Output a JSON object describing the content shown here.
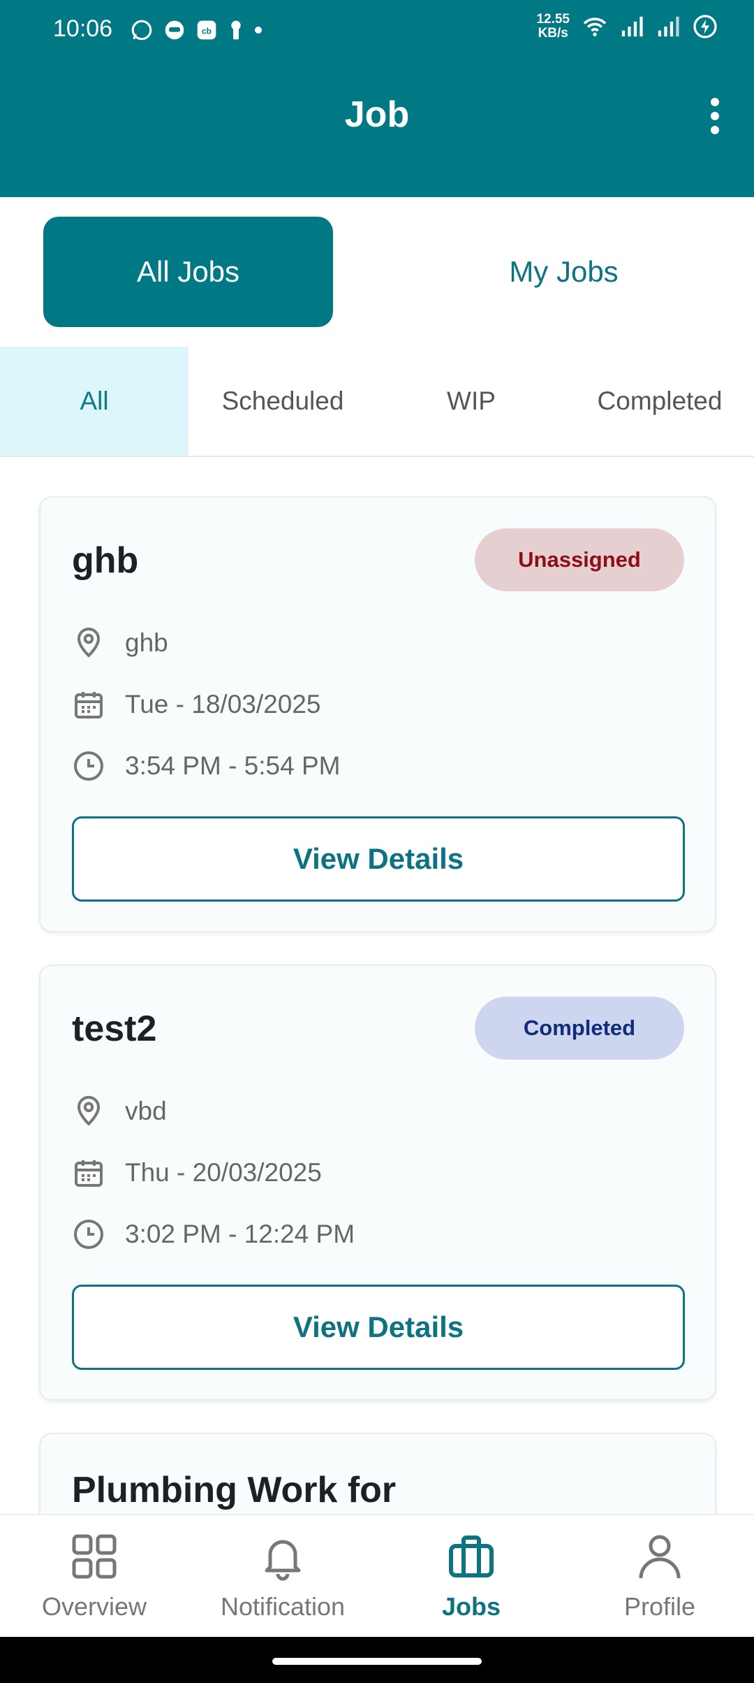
{
  "status_bar": {
    "time": "10:06",
    "net_speed_value": "12.55",
    "net_speed_unit": "KB/s"
  },
  "appbar": {
    "title": "Job"
  },
  "segments": {
    "all_jobs": "All Jobs",
    "my_jobs": "My Jobs",
    "selected": "All Jobs"
  },
  "tabs": [
    {
      "label": "All"
    },
    {
      "label": "Scheduled"
    },
    {
      "label": "WIP"
    },
    {
      "label": "Completed"
    }
  ],
  "jobs": [
    {
      "title": "ghb",
      "status": "Unassigned",
      "location": "ghb",
      "date": "Tue - 18/03/2025",
      "time": "3:54 PM - 5:54 PM",
      "button": "View Details"
    },
    {
      "title": "test2",
      "status": "Completed",
      "location": "vbd",
      "date": "Thu - 20/03/2025",
      "time": "3:02 PM - 12:24 PM",
      "button": "View Details"
    },
    {
      "title": "Plumbing Work for"
    }
  ],
  "colors": {
    "primary": "#017985",
    "unassigned_bg": "#e6cfd1",
    "unassigned_text": "#8d0f16",
    "completed_bg": "#cdd6ee",
    "completed_text": "#0f2d78"
  },
  "bottom_nav": [
    {
      "label": "Overview",
      "icon": "grid-icon"
    },
    {
      "label": "Notification",
      "icon": "bell-icon"
    },
    {
      "label": "Jobs",
      "icon": "briefcase-icon"
    },
    {
      "label": "Profile",
      "icon": "person-icon"
    }
  ]
}
